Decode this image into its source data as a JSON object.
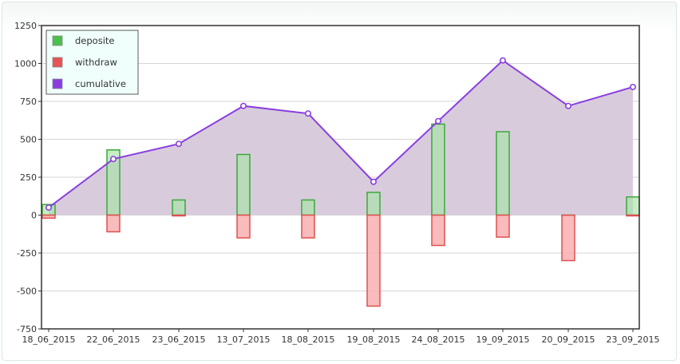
{
  "chart_data": {
    "type": "bar",
    "categories": [
      "18_06_2015",
      "22_06_2015",
      "23_06_2015",
      "13_07_2015",
      "18_08_2015",
      "19_08_2015",
      "24_08_2015",
      "19_09_2015",
      "20_09_2015",
      "23_09_2015"
    ],
    "series": [
      {
        "name": "deposite",
        "kind": "bar",
        "color": "#3aa83a",
        "fill": "#a8e4a8",
        "values": [
          70,
          430,
          100,
          400,
          100,
          150,
          600,
          550,
          0,
          120
        ]
      },
      {
        "name": "withdraw",
        "kind": "bar",
        "color": "#e05050",
        "fill": "#f8b4b4",
        "values": [
          -20,
          -110,
          -5,
          -150,
          -150,
          -600,
          -200,
          -145,
          -300,
          -5
        ]
      },
      {
        "name": "cumulative",
        "kind": "area-line",
        "color": "#8a3ee0",
        "fill": "#d8ccdc",
        "values": [
          50,
          370,
          470,
          720,
          670,
          220,
          620,
          1020,
          720,
          845
        ]
      }
    ],
    "ylim": [
      -750,
      1250
    ],
    "yticks": [
      "1250",
      "1000",
      "750",
      "500",
      "250",
      "0",
      "-250",
      "-500",
      "-750"
    ],
    "grid": true,
    "legend_position": "top-left"
  }
}
